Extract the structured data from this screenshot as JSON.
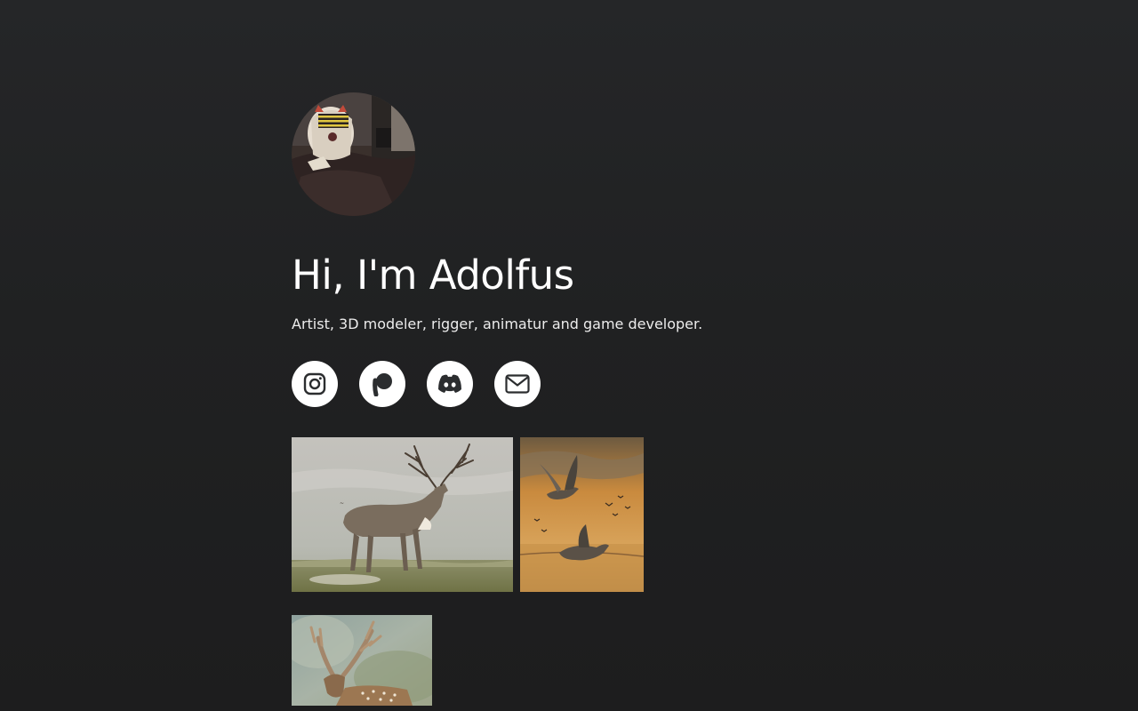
{
  "profile": {
    "name_heading": "Hi, I'm Adolfus",
    "bio": "Artist, 3D modeler, rigger, animatur and game developer.",
    "avatar_icon": "avatar-photo"
  },
  "socials": [
    {
      "icon": "instagram-icon"
    },
    {
      "icon": "patreon-icon"
    },
    {
      "icon": "discord-icon"
    },
    {
      "icon": "email-icon"
    }
  ],
  "gallery": [
    {
      "subject": "whitetail-deer-painting"
    },
    {
      "subject": "flying-ducks-painting"
    },
    {
      "subject": "fallow-deer-painting"
    }
  ],
  "colors": {
    "background_top": "#252628",
    "background_bottom": "#1d1d1e",
    "text": "#ffffff",
    "icon_button_bg": "#ffffff",
    "icon_fg": "#2b2d2f"
  }
}
